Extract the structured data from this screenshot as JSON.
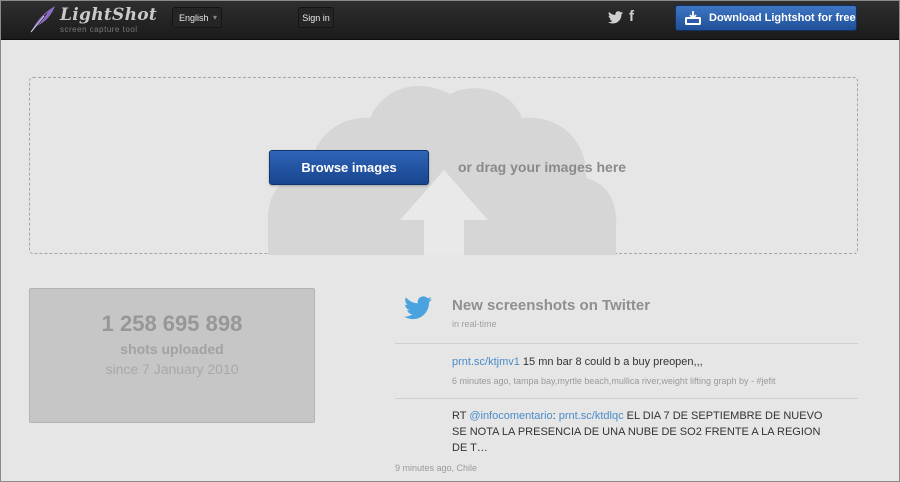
{
  "header": {
    "logo_name": "LightShot",
    "logo_tagline": "screen capture tool",
    "language": "English",
    "signin_label": "Sign in",
    "social": [
      "twitter-icon",
      "facebook-icon"
    ],
    "facebook_glyph": "f",
    "download_label": "Download Lightshot for free"
  },
  "upload": {
    "browse_label": "Browse images",
    "drag_text": "or drag your images here"
  },
  "counter": {
    "number": "1 258 695 898",
    "label": "shots uploaded",
    "since": "since 7 January 2010"
  },
  "twitter": {
    "title": "New screenshots on Twitter",
    "subtitle": "in real-time",
    "tweets": [
      {
        "link": "prnt.sc/ktjmv1",
        "text": " 15 mn bar 8 could b a buy preopen,,,",
        "meta": "6 minutes ago, tampa bay,myrtle beach,mullica river,weight lifting graph by - #jefit"
      },
      {
        "prefix": "RT ",
        "mention": "@infocomentario",
        "sep": ": ",
        "link": "prnt.sc/ktdlqc",
        "text_line1": " EL DIA 7 DE SEPTIEMBRE DE NUEVO",
        "text_line2": "SE NOTA LA PRESENCIA DE UNA NUBE DE SO2 FRENTE A LA REGION",
        "text_line3": "DE T…",
        "meta": "9 minutes ago, Chile"
      }
    ]
  },
  "colors": {
    "header_bg": "#222222",
    "button_blue": "#1f4f98",
    "link_blue": "#4a8cc7",
    "page_bg": "#e6e6e6"
  }
}
